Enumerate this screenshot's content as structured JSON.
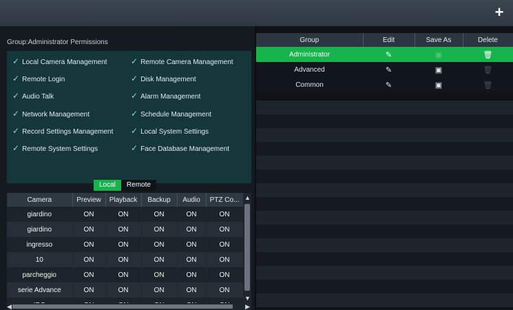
{
  "header": {
    "add_label": "+"
  },
  "permissions": {
    "group_title": "Group:Administrator Permissions",
    "items": [
      "Local Camera Management",
      "Remote Camera Management",
      "Remote Login",
      "Disk Management",
      "Audio Talk",
      "Alarm Management",
      "Network Management",
      "Schedule Management",
      "Record Settings Management",
      "Local System Settings",
      "Remote System Settings",
      "Face Database Management"
    ],
    "tabs": [
      "Local",
      "Remote"
    ],
    "columns": [
      "Camera",
      "Preview",
      "Playback",
      "Backup",
      "Audio",
      "PTZ Co..."
    ],
    "rows": [
      [
        "giardino",
        "ON",
        "ON",
        "ON",
        "ON",
        "ON"
      ],
      [
        "giardino",
        "ON",
        "ON",
        "ON",
        "ON",
        "ON"
      ],
      [
        "ingresso",
        "ON",
        "ON",
        "ON",
        "ON",
        "ON"
      ],
      [
        "10",
        "ON",
        "ON",
        "ON",
        "ON",
        "ON"
      ],
      [
        "parcheggio",
        "ON",
        "ON",
        "ON",
        "ON",
        "ON"
      ],
      [
        "serie Advance",
        "ON",
        "ON",
        "ON",
        "ON",
        "ON"
      ],
      [
        "IPC",
        "ON",
        "ON",
        "ON",
        "ON",
        "ON"
      ]
    ]
  },
  "groups": {
    "columns": [
      "Group",
      "Edit",
      "Save As",
      "Delete"
    ],
    "rows": [
      {
        "name": "Administrator",
        "selected": true,
        "edit_icon": "pencil-icon",
        "saveas_icon": "save-icon",
        "delete_icon": "trash-icon"
      },
      {
        "name": "Advanced",
        "selected": false,
        "edit_icon": "pencil-icon",
        "saveas_icon": "save-icon",
        "delete_icon": "trash-icon"
      },
      {
        "name": "Common",
        "selected": false,
        "edit_icon": "pencil-icon",
        "saveas_icon": "save-icon",
        "delete_icon": "trash-icon"
      }
    ]
  },
  "colors": {
    "accent": "#17b34d",
    "panel": "#15363b"
  }
}
